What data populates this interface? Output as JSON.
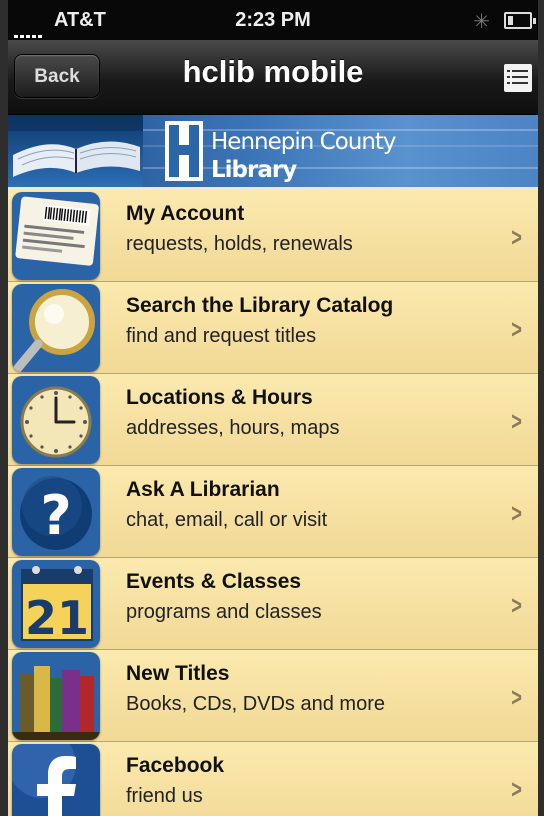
{
  "status_bar": {
    "carrier": "AT&T",
    "time": "2:23 PM"
  },
  "nav": {
    "back_label": "Back",
    "title": "hclib mobile"
  },
  "banner": {
    "brand_line1": "Hennepin County",
    "brand_line2": "Library"
  },
  "items": [
    {
      "title": "My Account",
      "subtitle": "requests, holds, renewals",
      "icon": "library-card-icon"
    },
    {
      "title": "Search the Library Catalog",
      "subtitle": "find and request titles",
      "icon": "magnifier-icon"
    },
    {
      "title": "Locations & Hours",
      "subtitle": "addresses, hours, maps",
      "icon": "clock-icon"
    },
    {
      "title": "Ask A Librarian",
      "subtitle": "chat, email, call or visit",
      "icon": "question-icon"
    },
    {
      "title": "Events & Classes",
      "subtitle": "programs and classes",
      "icon": "calendar-icon",
      "calendar_day": "21"
    },
    {
      "title": "New Titles",
      "subtitle": "Books, CDs, DVDs and more",
      "icon": "books-icon"
    },
    {
      "title": "Facebook",
      "subtitle": "friend us",
      "icon": "facebook-icon"
    }
  ],
  "colors": {
    "list_bg": "#f4e0a0",
    "navbar": "#1a1a1a",
    "banner": "#3b74b6",
    "icon_blue": "#1f5a9c"
  }
}
